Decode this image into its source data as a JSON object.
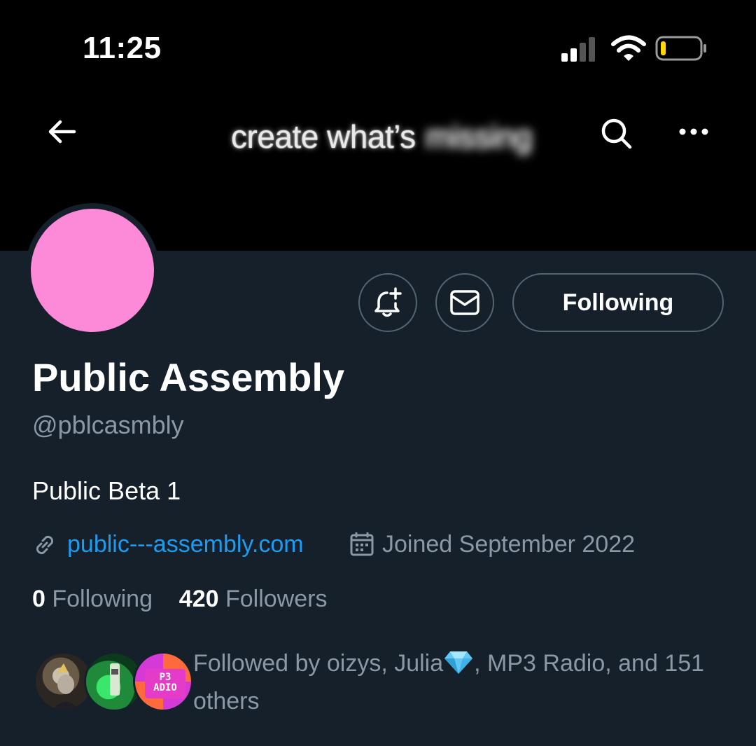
{
  "status_bar": {
    "time": "11:25",
    "icons": [
      "signal-icon",
      "wifi-icon",
      "battery-icon"
    ]
  },
  "header": {
    "banner_text": "create what’s",
    "banner_text_blurred": "missing",
    "icons": [
      "back-arrow-icon",
      "search-icon",
      "more-icon"
    ]
  },
  "actions": {
    "notifications_icon": "bell-plus-icon",
    "message_icon": "envelope-icon",
    "follow_label": "Following"
  },
  "profile": {
    "avatar_color": "#fd8ad9",
    "name": "Public Assembly",
    "handle": "@pblcasmbly",
    "bio": "Public Beta 1",
    "website": "public---assembly.com",
    "joined": "Joined September 2022",
    "following_count": "0",
    "following_label": "Following",
    "followers_count": "420",
    "followers_label": "Followers"
  },
  "followed_by": {
    "prefix": "Followed by oizys, Julia",
    "suffix": ", MP3 Radio, and 151 others",
    "avatar_badge": "P3 ADIO"
  },
  "colors": {
    "background": "#15202b",
    "header": "#000000",
    "link": "#1d9bf0",
    "secondary_text": "#8b98a5",
    "border": "#536471"
  }
}
